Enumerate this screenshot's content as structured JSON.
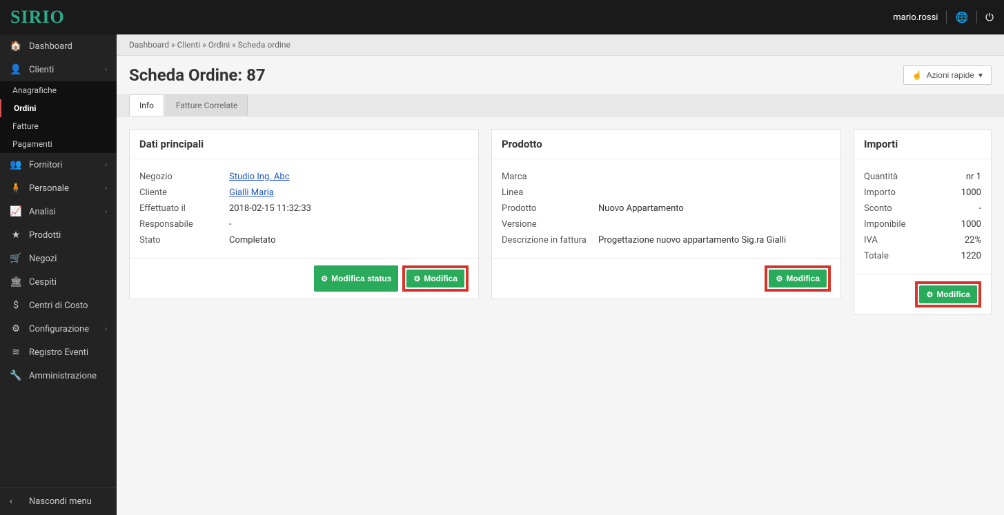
{
  "brand": "SIRIO",
  "user": "mario.rossi",
  "breadcrumb": {
    "p0": "Dashboard",
    "p1": "Clienti",
    "p2": "Ordini",
    "p3": "Scheda ordine"
  },
  "page_title": "Scheda Ordine: 87",
  "quick_actions": "Azioni rapide",
  "sidebar": {
    "dashboard": "Dashboard",
    "clienti": "Clienti",
    "sub": {
      "anagrafiche": "Anagrafiche",
      "ordini": "Ordini",
      "fatture": "Fatture",
      "pagamenti": "Pagamenti"
    },
    "fornitori": "Fornitori",
    "personale": "Personale",
    "analisi": "Analisi",
    "prodotti": "Prodotti",
    "negozi": "Negozi",
    "cespiti": "Cespiti",
    "centri": "Centri di Costo",
    "config": "Configurazione",
    "registro": "Registro Eventi",
    "admin": "Amministrazione",
    "hide": "Nascondi menu"
  },
  "tabs": {
    "info": "Info",
    "fatture": "Fatture Correlate"
  },
  "buttons": {
    "modifica": "Modifica",
    "modifica_status": "Modifica status"
  },
  "dati": {
    "title": "Dati principali",
    "negozio_l": "Negozio",
    "negozio_v": "Studio Ing. Abc",
    "cliente_l": "Cliente",
    "cliente_v": "Gialli Maria",
    "effettuato_l": "Effettuato il",
    "effettuato_v": "2018-02-15 11:32:33",
    "resp_l": "Responsabile",
    "resp_v": "-",
    "stato_l": "Stato",
    "stato_v": "Completato"
  },
  "prodotto": {
    "title": "Prodotto",
    "marca_l": "Marca",
    "marca_v": "",
    "linea_l": "Linea",
    "linea_v": "",
    "prodotto_l": "Prodotto",
    "prodotto_v": "Nuovo Appartamento",
    "versione_l": "Versione",
    "versione_v": "",
    "desc_l": "Descrizione in fattura",
    "desc_v": "Progettazione nuovo appartamento Sig.ra Gialli"
  },
  "importi": {
    "title": "Importi",
    "quantita_l": "Quantità",
    "quantita_v": "nr 1",
    "importo_l": "Importo",
    "importo_v": "1000",
    "sconto_l": "Sconto",
    "sconto_v": "-",
    "imponibile_l": "Imponibile",
    "imponibile_v": "1000",
    "iva_l": "IVA",
    "iva_v": "22%",
    "totale_l": "Totale",
    "totale_v": "1220"
  }
}
